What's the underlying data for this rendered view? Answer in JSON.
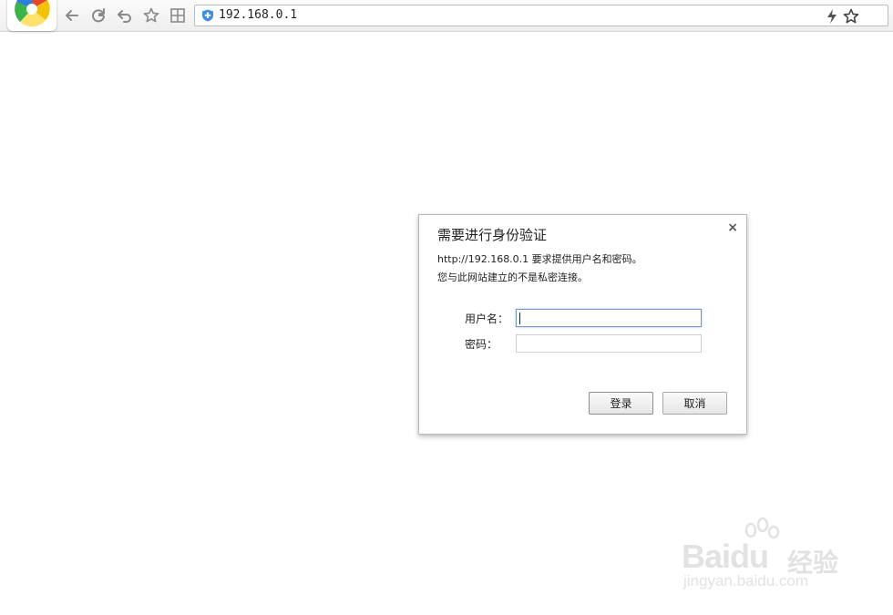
{
  "browser": {
    "address": "192.168.0.1",
    "icons": {
      "logo": "browser-logo-icon",
      "back": "back-icon",
      "refresh": "refresh-icon",
      "undo": "undo-close-tab-icon",
      "favorite": "favorite-star-icon",
      "apps": "apps-grid-icon",
      "security": "shield-icon",
      "speed": "lightning-icon",
      "bookmark": "bookmark-star-icon"
    }
  },
  "dialog": {
    "title": "需要进行身份验证",
    "message_line1": "http://192.168.0.1 要求提供用户名和密码。",
    "message_line2": "您与此网站建立的不是私密连接。",
    "username_label": "用户名：",
    "username_value": "",
    "password_label": "密码：",
    "password_value": "",
    "login_button": "登录",
    "cancel_button": "取消",
    "close_glyph": "×"
  },
  "watermark": {
    "brand": "Baidu",
    "brand_cn": "经验",
    "url": "jingyan.baidu.com"
  },
  "colors": {
    "accent_focus": "#6f99c8",
    "dialog_border": "#b9b9b9",
    "toolbar_bg": "#f2f2f2",
    "watermark": "#e2e2e2"
  }
}
